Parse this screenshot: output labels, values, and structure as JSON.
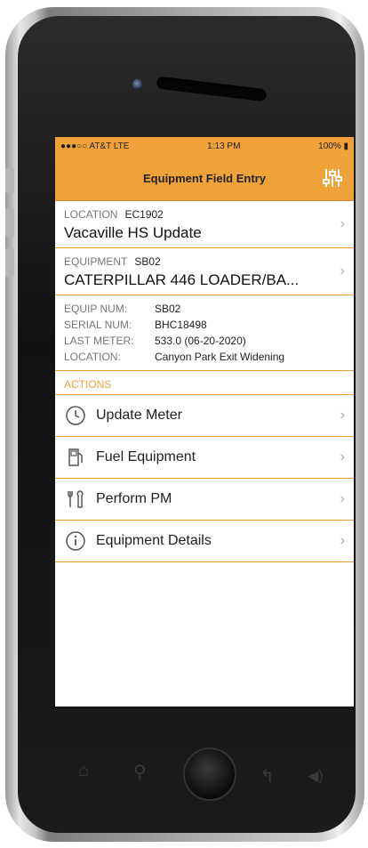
{
  "status": {
    "carrier": "●●●○○ AT&T",
    "network": "LTE",
    "time": "1:13 PM",
    "battery": "100%"
  },
  "nav": {
    "title": "Equipment Field Entry",
    "filter_icon": "sliders-icon"
  },
  "location": {
    "label": "LOCATION",
    "code": "EC1902",
    "name": "Vacaville HS Update"
  },
  "equipment": {
    "label": "EQUIPMENT",
    "code": "SB02",
    "name": "CATERPILLAR 446 LOADER/BA..."
  },
  "details": [
    {
      "key": "EQUIP NUM:",
      "value": "SB02"
    },
    {
      "key": "SERIAL NUM:",
      "value": "BHC18498"
    },
    {
      "key": "LAST METER:",
      "value": "533.0 (06-20-2020)"
    },
    {
      "key": "LOCATION:",
      "value": "Canyon Park Exit Widening"
    }
  ],
  "actions_header": "ACTIONS",
  "actions": [
    {
      "label": "Update Meter",
      "icon": "clock-icon"
    },
    {
      "label": "Fuel Equipment",
      "icon": "fuel-pump-icon"
    },
    {
      "label": "Perform PM",
      "icon": "wrench-icon"
    },
    {
      "label": "Equipment Details",
      "icon": "info-icon"
    }
  ],
  "colors": {
    "accent": "#f0a23a"
  }
}
